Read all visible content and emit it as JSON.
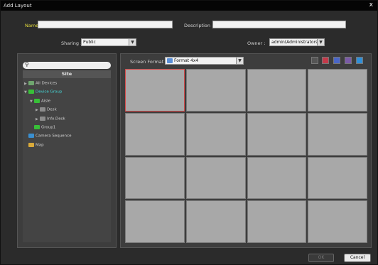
{
  "window": {
    "title": "Add Layout",
    "close_glyph": "x"
  },
  "form": {
    "name_label": "Name :",
    "name_value": "",
    "description_label": "Description :",
    "description_value": "",
    "sharing_label": "Sharing :",
    "sharing_value": "Public",
    "owner_label": "Owner :",
    "owner_value": "admin(Administrators)"
  },
  "site_panel": {
    "search_placeholder": "",
    "header": "Site",
    "tree": [
      {
        "label": "All Devices",
        "icon": "devices-icon",
        "color": "#6fa66f"
      },
      {
        "label": "Device Group",
        "icon": "group-icon",
        "color": "#38c038",
        "selected": true
      },
      {
        "label": "Aisle",
        "icon": "group-icon",
        "color": "#38c038"
      },
      {
        "label": "Desk",
        "icon": "device-icon",
        "color": "#8c8c8c"
      },
      {
        "label": "Info.Desk",
        "icon": "device-icon",
        "color": "#8c8c8c"
      },
      {
        "label": "Group1",
        "icon": "group-icon",
        "color": "#38c038"
      },
      {
        "label": "Camera Sequence",
        "icon": "camera-sequence-icon",
        "color": "#3a8fd0"
      },
      {
        "label": "Map",
        "icon": "map-icon",
        "color": "#d8a93a"
      }
    ]
  },
  "layout_panel": {
    "screen_format_label": "Screen Format :",
    "screen_format_value": "Format 4x4",
    "rows": 4,
    "cols": 4,
    "toolbar_icons": [
      "delete-icon",
      "red-grid-icon",
      "blue-grid-icon",
      "purple-grid-icon",
      "blue-window-icon"
    ]
  },
  "buttons": {
    "ok_label": "OK",
    "cancel_label": "Cancel"
  },
  "colors": {
    "accent_yellow": "#e6de3c",
    "selection_cyan": "#44d6d6",
    "active_cell_border": "#d24a4a"
  }
}
